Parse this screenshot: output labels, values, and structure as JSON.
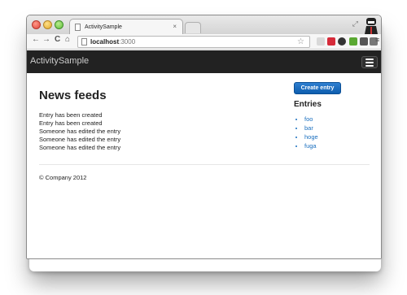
{
  "browser": {
    "tab_title": "ActivitySample",
    "tab_close": "×",
    "address_host": "localhost",
    "address_port": ":3000",
    "back_icon": "arrow-left-icon",
    "forward_icon": "arrow-right-icon",
    "reload_icon": "reload-icon",
    "home_icon": "home-icon"
  },
  "navbar": {
    "brand": "ActivitySample",
    "bg_color": "#222222"
  },
  "main": {
    "title": "News feeds",
    "feed": [
      "Entry has been created",
      "Entry has been created",
      "Someone has edited the entry",
      "Someone has edited the entry",
      "Someone has edited the entry"
    ]
  },
  "sidebar": {
    "create_button": "Create entry",
    "entries_heading": "Entries",
    "entries": [
      "foo",
      "bar",
      "hoge",
      "fuga"
    ],
    "link_color": "#1a6fbf"
  },
  "footer": {
    "text": "© Company 2012"
  }
}
